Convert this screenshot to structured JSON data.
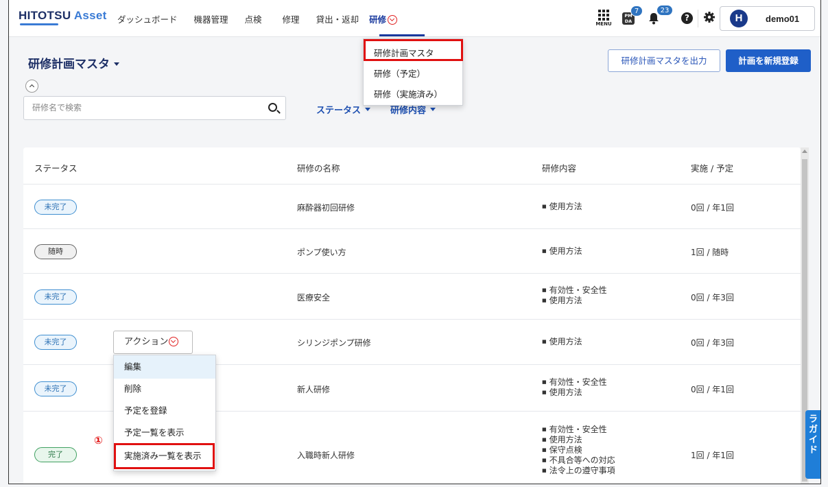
{
  "header": {
    "logo_main": "HITOTSU",
    "logo_sub": "Asset",
    "nav": [
      {
        "label": "ダッシュボード"
      },
      {
        "label": "機器管理"
      },
      {
        "label": "点検"
      },
      {
        "label": "修理"
      },
      {
        "label": "貸出・返却"
      },
      {
        "label": "研修"
      }
    ],
    "menu_label": "MENU",
    "pmda_label": "PM DA",
    "pmda_badge": "7",
    "notification_badge": "23",
    "help_glyph": "?",
    "user_initial": "H",
    "user_name": "demo01"
  },
  "nav_dropdown": {
    "items": [
      {
        "label": "研修計画マスタ"
      },
      {
        "label": "研修（予定）"
      },
      {
        "label": "研修（実施済み）"
      }
    ]
  },
  "page": {
    "title": "研修計画マスタ",
    "export_button": "研修計画マスタを出力",
    "new_button": "計画を新規登録",
    "search_placeholder": "研修名で検索",
    "filter_status": "ステータス",
    "filter_content": "研修内容"
  },
  "table": {
    "headers": {
      "status": "ステータス",
      "name": "研修の名称",
      "content": "研修内容",
      "count": "実施 / 予定"
    },
    "rows": [
      {
        "status": "未完了",
        "name": "麻酔器初回研修",
        "content": [
          "使用方法"
        ],
        "count": "0回 / 年1回"
      },
      {
        "status": "随時",
        "name": "ポンプ使い方",
        "content": [
          "使用方法"
        ],
        "count": "1回 / 随時"
      },
      {
        "status": "未完了",
        "name": "医療安全",
        "content": [
          "有効性・安全性",
          "使用方法"
        ],
        "count": "0回 / 年3回"
      },
      {
        "status": "未完了",
        "name": "シリンジポンプ研修",
        "content": [
          "使用方法"
        ],
        "count": "0回 / 年3回"
      },
      {
        "status": "未完了",
        "name": "新人研修",
        "content": [
          "有効性・安全性",
          "使用方法"
        ],
        "count": "0回 / 年1回"
      },
      {
        "status": "完了",
        "name": "入職時新人研修",
        "content": [
          "有効性・安全性",
          "使用方法",
          "保守点検",
          "不具合等への対応",
          "法令上の遵守事項"
        ],
        "count": "1回 / 年1回"
      }
    ]
  },
  "action_menu": {
    "button_label": "アクション",
    "items": [
      {
        "label": "編集"
      },
      {
        "label": "削除"
      },
      {
        "label": "予定を登録"
      },
      {
        "label": "予定一覧を表示"
      },
      {
        "label": "実施済み一覧を表示"
      }
    ]
  },
  "annotation_marker": "①",
  "guide_tab_text": "ラガイド",
  "colors": {
    "brand_navy": "#1d2f66",
    "primary_blue": "#1f5fc8",
    "highlight_red": "#e01010"
  }
}
